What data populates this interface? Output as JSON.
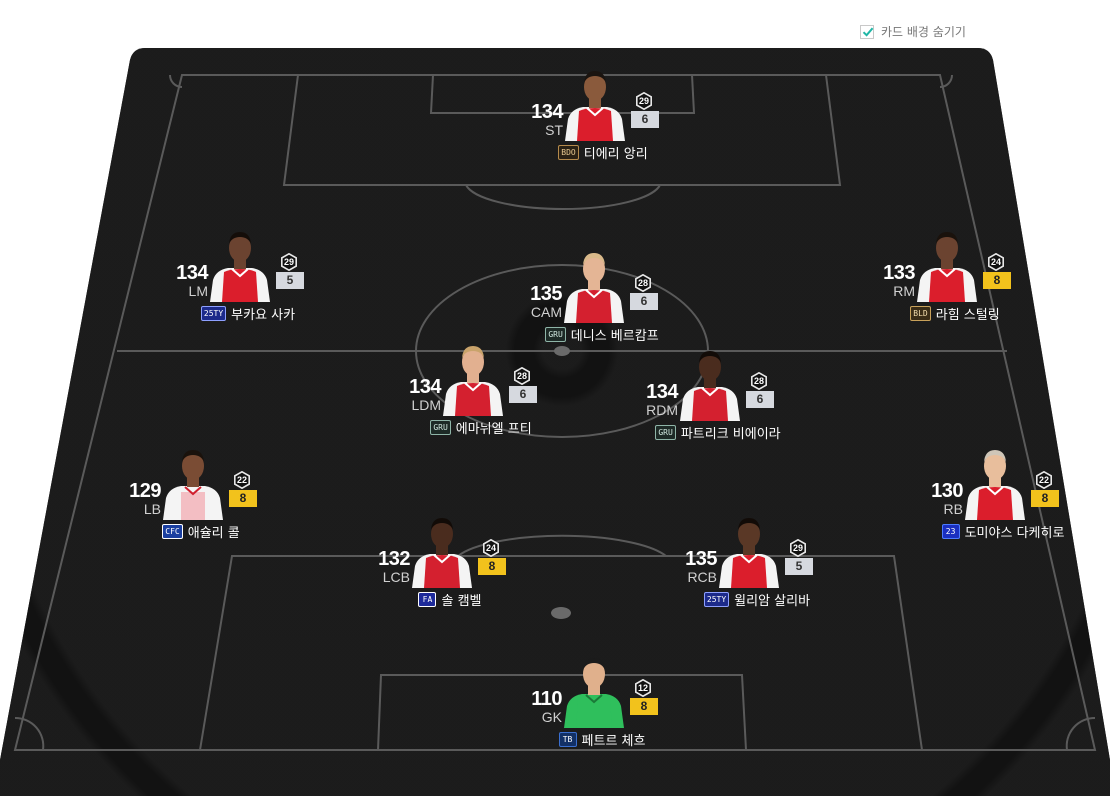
{
  "toggle": {
    "label": "카드 배경 숨기기",
    "checked": true,
    "check_color": "#1fb6a6"
  },
  "formation": "4-4-2 (4-2-2-2)",
  "colors": {
    "pitch": "#161616",
    "lines": "#5c5c5c",
    "level_silver": "#d6d9df",
    "level_gold": "#f2c21c"
  },
  "players": [
    {
      "id": "st",
      "ovr": "134",
      "pos": "ST",
      "name": "티에리 앙리",
      "season_icon": "BDO",
      "season_style": "bdo",
      "upgrade": "29",
      "level": "6",
      "level_tier": "silver",
      "kit": "arsenal-home",
      "skin": "#8a5a3c",
      "hair": "#1a1410"
    },
    {
      "id": "lm",
      "ovr": "134",
      "pos": "LM",
      "name": "부카요 사카",
      "season_icon": "25TY",
      "season_style": "25ty",
      "upgrade": "29",
      "level": "5",
      "level_tier": "silver",
      "kit": "arsenal-home",
      "skin": "#6b4330",
      "hair": "#140d09"
    },
    {
      "id": "cam",
      "ovr": "135",
      "pos": "CAM",
      "name": "데니스 베르캄프",
      "season_icon": "GRU",
      "season_style": "gru",
      "upgrade": "28",
      "level": "6",
      "level_tier": "silver",
      "kit": "arsenal-retro",
      "skin": "#e4b595",
      "hair": "#d9b98a"
    },
    {
      "id": "rm",
      "ovr": "133",
      "pos": "RM",
      "name": "라힘 스털링",
      "season_icon": "BLD",
      "season_style": "bld",
      "upgrade": "24",
      "level": "8",
      "level_tier": "gold",
      "kit": "arsenal-home",
      "skin": "#6b4330",
      "hair": "#1a120c"
    },
    {
      "id": "ldm",
      "ovr": "134",
      "pos": "LDM",
      "name": "에마뉘엘 프티",
      "season_icon": "GRU",
      "season_style": "gru",
      "upgrade": "28",
      "level": "6",
      "level_tier": "silver",
      "kit": "arsenal-retro",
      "skin": "#e2b090",
      "hair": "#c9a36b"
    },
    {
      "id": "rdm",
      "ovr": "134",
      "pos": "RDM",
      "name": "파트리크 비에이라",
      "season_icon": "GRU",
      "season_style": "gru",
      "upgrade": "28",
      "level": "6",
      "level_tier": "silver",
      "kit": "arsenal-retro",
      "skin": "#4a2c1e",
      "hair": "#120b07"
    },
    {
      "id": "lb",
      "ovr": "129",
      "pos": "LB",
      "name": "애슐리 콜",
      "season_icon": "CFC",
      "season_style": "chelsea",
      "upgrade": "22",
      "level": "8",
      "level_tier": "gold",
      "kit": "white-red",
      "skin": "#7a4c34",
      "hair": "#1a120c"
    },
    {
      "id": "lcb",
      "ovr": "132",
      "pos": "LCB",
      "name": "솔 캠벨",
      "season_icon": "FA",
      "season_style": "fa",
      "upgrade": "24",
      "level": "8",
      "level_tier": "gold",
      "kit": "arsenal-retro",
      "skin": "#4a2c1e",
      "hair": "#120b07"
    },
    {
      "id": "rcb",
      "ovr": "135",
      "pos": "RCB",
      "name": "윌리암 살리바",
      "season_icon": "25TY",
      "season_style": "25ty",
      "upgrade": "29",
      "level": "5",
      "level_tier": "silver",
      "kit": "arsenal-home",
      "skin": "#5a3826",
      "hair": "#120b07"
    },
    {
      "id": "rb",
      "ovr": "130",
      "pos": "RB",
      "name": "도미야스 다케히로",
      "season_icon": "23",
      "season_style": "s23",
      "upgrade": "22",
      "level": "8",
      "level_tier": "gold",
      "kit": "arsenal-home",
      "skin": "#e8be9c",
      "hair": "#cfc6b8"
    },
    {
      "id": "gk",
      "ovr": "110",
      "pos": "GK",
      "name": "페트르 체흐",
      "season_icon": "TB",
      "season_style": "tb",
      "upgrade": "12",
      "level": "8",
      "level_tier": "gold",
      "kit": "gk-green",
      "skin": "#e0b08c",
      "hair": "#1b1b1b"
    }
  ]
}
